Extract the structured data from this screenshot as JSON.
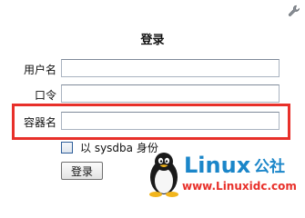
{
  "dialog": {
    "title": "登录",
    "fields": [
      {
        "label": "用户名",
        "value": ""
      },
      {
        "label": "口令",
        "value": ""
      },
      {
        "label": "容器名",
        "value": ""
      }
    ],
    "checkbox": {
      "label": "以 sysdba 身份",
      "checked": false
    },
    "submit_label": "登录"
  },
  "highlight_color": "#e8302a",
  "watermark": {
    "brand": "Linux",
    "brand_cn": "公社",
    "url": "www.Linuxidc.com",
    "brand_color": "#1b86c9",
    "url_color": "#e8302a"
  },
  "icons": {
    "corner": "wrench-icon",
    "mascot": "tux-penguin-icon"
  }
}
